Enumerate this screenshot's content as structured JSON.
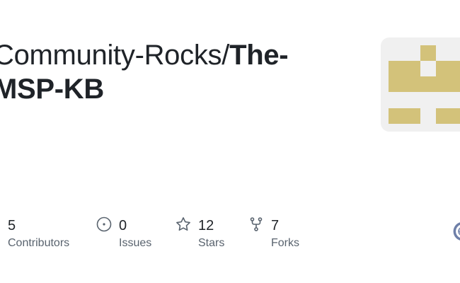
{
  "repo": {
    "owner": "Community-Rocks",
    "slash": "/",
    "name_line1": "The-",
    "name_line2": "MSP-KB"
  },
  "avatar": {
    "icon": "org-identicon",
    "color": "#d3c27a",
    "background": "#f0f0f0"
  },
  "stats": {
    "contributors": {
      "count": "5",
      "label": "Contributors"
    },
    "issues": {
      "count": "0",
      "label": "Issues",
      "icon": "issue-icon"
    },
    "stars": {
      "count": "12",
      "label": "Stars",
      "icon": "star-icon"
    },
    "forks": {
      "count": "7",
      "label": "Forks",
      "icon": "fork-icon"
    }
  },
  "brand": {
    "icon": "github-icon",
    "text_color": "#1f2328",
    "muted_color": "#59636e",
    "icon_color": "#59636e"
  }
}
